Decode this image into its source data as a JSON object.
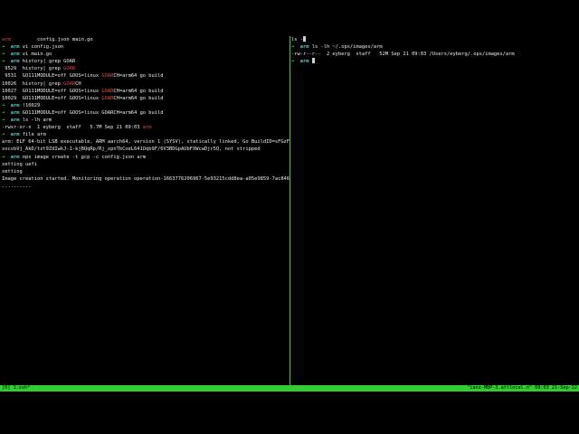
{
  "panes": {
    "left": {
      "lines": [
        [
          {
            "t": "arm",
            "c": "red"
          },
          {
            "t": "         config.json main.go",
            "c": "white"
          }
        ],
        [
          {
            "t": "➜  ",
            "c": "green"
          },
          {
            "t": "arm",
            "c": "cyan"
          },
          {
            "t": " vi config.json",
            "c": "white"
          }
        ],
        [
          {
            "t": "➜  ",
            "c": "green"
          },
          {
            "t": "arm",
            "c": "cyan"
          },
          {
            "t": " vi main.go",
            "c": "white"
          }
        ],
        [
          {
            "t": "➜  ",
            "c": "green"
          },
          {
            "t": "arm",
            "c": "cyan"
          },
          {
            "t": " history| grep GOAR",
            "c": "white"
          }
        ],
        [
          {
            "t": " 9529  history| grep ",
            "c": "white"
          },
          {
            "t": "GOAR",
            "c": "red"
          }
        ],
        [
          {
            "t": " 9531  GO111MODULE=off GOOS=linux ",
            "c": "white"
          },
          {
            "t": "GOAR",
            "c": "red"
          },
          {
            "t": "CH=arm64 go build",
            "c": "white"
          }
        ],
        [
          {
            "t": "10026  history| grep ",
            "c": "white"
          },
          {
            "t": "GOAR",
            "c": "red"
          },
          {
            "t": "CH",
            "c": "white"
          }
        ],
        [
          {
            "t": "10027  GO111MODULE=off GOOS=linux ",
            "c": "white"
          },
          {
            "t": "GOAR",
            "c": "red"
          },
          {
            "t": "CH=arm64 go build",
            "c": "white"
          }
        ],
        [
          {
            "t": "10029  GO111MODULE=off GOOS=linux ",
            "c": "white"
          },
          {
            "t": "GOAR",
            "c": "red"
          },
          {
            "t": "CH=arm64 go build",
            "c": "white"
          }
        ],
        [
          {
            "t": "➜  ",
            "c": "green"
          },
          {
            "t": "arm",
            "c": "cyan"
          },
          {
            "t": " !10029",
            "c": "white"
          }
        ],
        [
          {
            "t": "➜  ",
            "c": "green"
          },
          {
            "t": "arm",
            "c": "cyan"
          },
          {
            "t": " GO111MODULE=off GOOS=linux GOARCH=arm64 go build",
            "c": "white"
          }
        ],
        [
          {
            "t": "➜  ",
            "c": "green"
          },
          {
            "t": "arm",
            "c": "cyan"
          },
          {
            "t": " ls -lh arm",
            "c": "white"
          }
        ],
        [
          {
            "t": "-rwxr-xr-x  1 eyberg  staff   5.7M Sep 21 09:03 ",
            "c": "white"
          },
          {
            "t": "arm",
            "c": "red"
          }
        ],
        [
          {
            "t": "➜  ",
            "c": "green"
          },
          {
            "t": "arm",
            "c": "cyan"
          },
          {
            "t": " file arm",
            "c": "white"
          }
        ],
        [
          {
            "t": "arm: ELF 64-bit LSB executable, ARM aarch64, version 1 (SYSV), statically linked, Go BuildID=sFGzFXfwK",
            "c": "white"
          }
        ],
        [
          {
            "t": "xocvbVj_AkD/tzt9ZdIwkJ-1-kjBQqRp/Rj_xpnTbCoeL641Oqb9F/6V3BDGpAUbFXWcwDjr5Q, not stripped",
            "c": "white"
          }
        ],
        [
          {
            "t": "➜  ",
            "c": "green"
          },
          {
            "t": "arm",
            "c": "cyan"
          },
          {
            "t": " ops image create -t gcp -c config.json arm",
            "c": "white"
          }
        ],
        [
          {
            "t": "setting uefi",
            "c": "white"
          }
        ],
        [
          {
            "t": "setting",
            "c": "white"
          }
        ],
        [
          {
            "t": "Image creation started. Monitoring operation operation-1663776206967-5e93215cdd8ea-a05e9859-7ac84613.",
            "c": "white"
          }
        ],
        [
          {
            "t": "..........",
            "c": "white"
          }
        ]
      ]
    },
    "right": {
      "lines": [
        [
          {
            "t": "ls -",
            "c": "white"
          },
          {
            "t": "",
            "c": "cursor"
          }
        ],
        [
          {
            "t": "➜  ",
            "c": "green"
          },
          {
            "t": "arm",
            "c": "cyan"
          },
          {
            "t": " ls -lh ~/.ops/images/arm",
            "c": "white"
          }
        ],
        [
          {
            "t": "-rw-r--r--  2 eyberg  staff   52M Sep 21 09:03 /Users/eyberg/.ops/images/arm",
            "c": "white"
          }
        ],
        [
          {
            "t": "➜  ",
            "c": "green"
          },
          {
            "t": "arm",
            "c": "cyan"
          },
          {
            "t": " ",
            "c": "white"
          },
          {
            "t": "",
            "c": "cursor"
          }
        ]
      ]
    }
  },
  "status_bar": {
    "window": "[0] 1:zsh*",
    "host": "\"ians-MBP-3.attlocal.n\" 09:03 21-Sep-22"
  }
}
